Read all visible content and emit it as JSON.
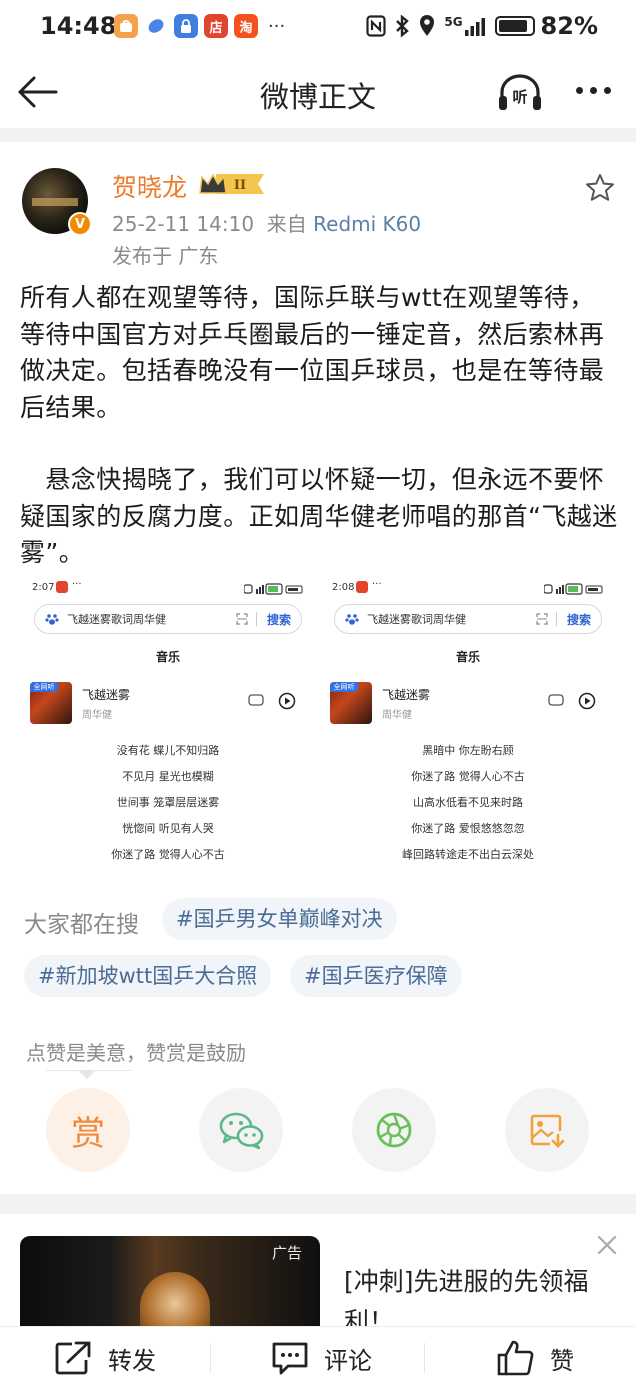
{
  "status_bar": {
    "time": "14:48",
    "app_icons": [
      {
        "name": "taobao-treasure-icon",
        "glyph": "▢",
        "color": "#f5a04a"
      },
      {
        "name": "blue-app-icon",
        "glyph": "◆",
        "color": "#4a86e8"
      },
      {
        "name": "lock-app-icon",
        "glyph": "▣",
        "color": "#3f7fe0"
      },
      {
        "name": "dian-app-icon",
        "glyph": "店",
        "color": "#e2452f"
      },
      {
        "name": "taobao-app-icon",
        "glyph": "淘",
        "color": "#f4511e"
      }
    ],
    "more": "···",
    "network": "5G",
    "battery_percent": "82%"
  },
  "header": {
    "title": "微博正文"
  },
  "post": {
    "author": {
      "name": "贺晓龙",
      "verified_badge": "V",
      "level_badge": "II"
    },
    "timestamp": "25-2-11 14:10",
    "source_prefix": "来自",
    "source": "Redmi K60",
    "location": "发布于 广东",
    "paragraphs": [
      "所有人都在观望等待，国际乒联与wtt在观望等待，等待中国官方对乒乓圈最后的一锤定音，然后索林再做决定。包括春晚没有一位国乒球员，也是在等待最后结果。",
      "　悬念快揭晓了，我们可以怀疑一切，但永远不要怀疑国家的反腐力度。正如周华健老师唱的那首“飞越迷雾”。"
    ],
    "images": [
      {
        "time": "2:07",
        "search_query": "飞越迷雾歌词周华健",
        "search_button": "搜索",
        "tab": "音乐",
        "cover_tag": "全网听",
        "song_title": "飞越迷雾",
        "artist": "周华健",
        "lyrics": [
          "没有花 蝶儿不知归路",
          "不见月 星光也模糊",
          "世间事 笼罩层层迷雾",
          "恍惚间 听见有人哭",
          "你迷了路 觉得人心不古"
        ]
      },
      {
        "time": "2:08",
        "search_query": "飞越迷雾歌词周华健",
        "search_button": "搜索",
        "tab": "音乐",
        "cover_tag": "全网听",
        "song_title": "飞越迷雾",
        "artist": "周华健",
        "lyrics": [
          "黑暗中 你左盼右顾",
          "你迷了路 觉得人心不古",
          "山高水低看不见来时路",
          "你迷了路 爱恨悠悠忽忽",
          "峰回路转途走不出白云深处"
        ]
      }
    ]
  },
  "hot_search": {
    "label": "大家都在搜",
    "topics": [
      "#国乒男女单巅峰对决",
      "#新加坡wtt国乒大合照",
      "#国乒医疗保障"
    ]
  },
  "reward": {
    "note": "点赞是美意，赞赏是鼓励",
    "reward_glyph": "赏"
  },
  "ad": {
    "tag": "广告",
    "title": "[冲刺]先进服的先领福利！"
  },
  "toolbar": {
    "repost": "转发",
    "comment": "评论",
    "like": "赞"
  },
  "colors": {
    "author_name": "#ef7b2a",
    "topic_text": "#4a6d96",
    "topic_bg": "#f1f4f8",
    "source_link": "#5b7fa6",
    "search_button": "#3064d6"
  }
}
